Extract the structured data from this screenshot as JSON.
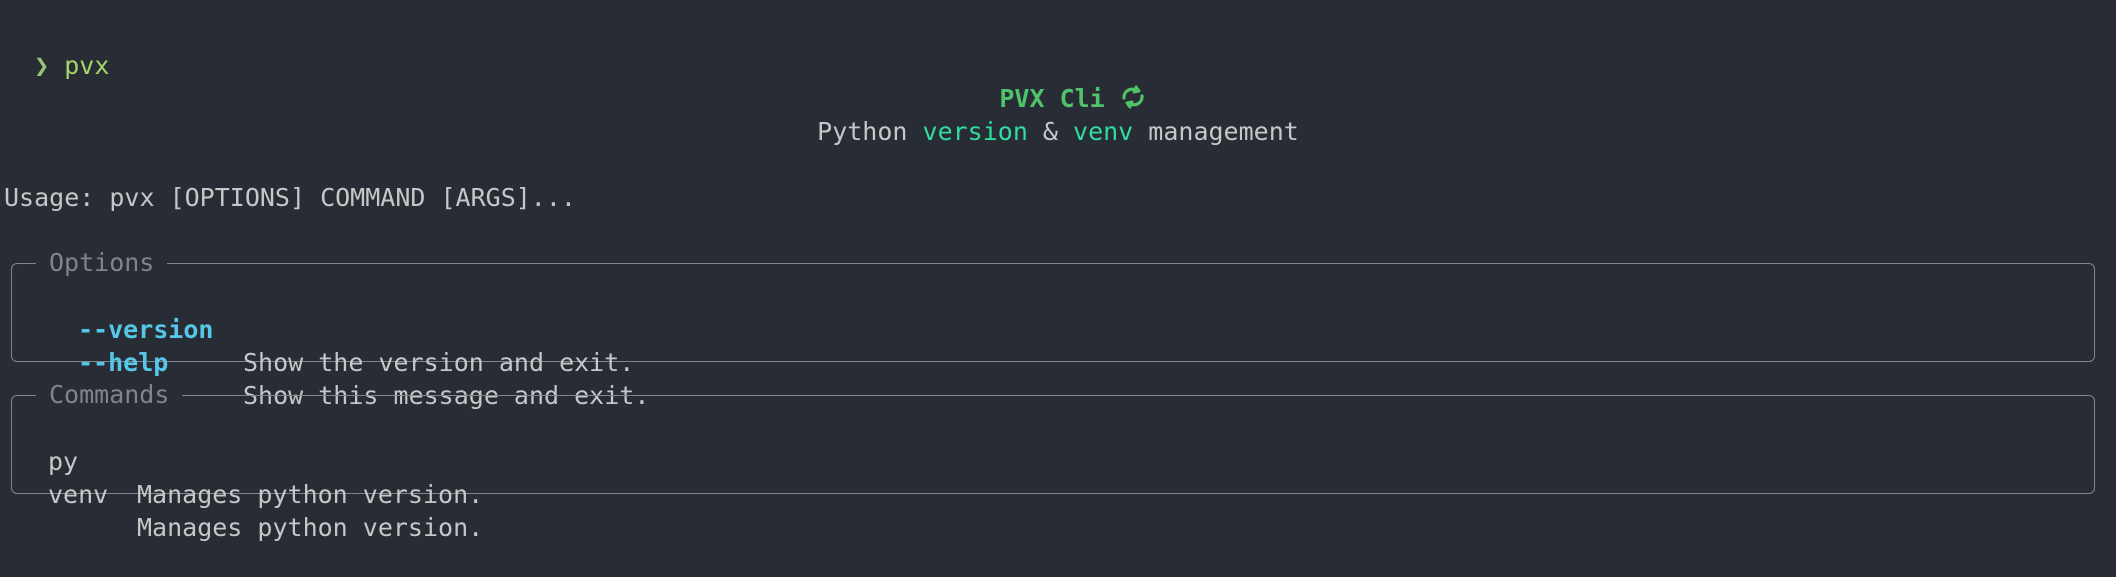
{
  "terminal": {
    "prompt_symbol": "❯",
    "command": "pvx"
  },
  "header": {
    "title": "PVX Cli",
    "title_icon": "loop-arrows-icon",
    "subtitle_prefix": "Python ",
    "subtitle_word1": "version",
    "subtitle_mid": " & ",
    "subtitle_word2": "venv",
    "subtitle_suffix": " management"
  },
  "usage": "Usage: pvx [OPTIONS] COMMAND [ARGS]...",
  "options_panel": {
    "title": "Options",
    "items": [
      {
        "flag": "--version",
        "description": "Show the version and exit."
      },
      {
        "flag": "--help",
        "description": "Show this message and exit."
      }
    ]
  },
  "commands_panel": {
    "title": "Commands",
    "items": [
      {
        "name": "py",
        "description": "Manages python version."
      },
      {
        "name": "venv",
        "description": "Manages python version."
      }
    ]
  },
  "colors": {
    "background": "#282c34",
    "prompt": "#98c379",
    "title": "#4fc36a",
    "accent": "#2fdd9c",
    "flag": "#56c7e6",
    "border": "#7f848e",
    "text": "#c5c8c6"
  }
}
